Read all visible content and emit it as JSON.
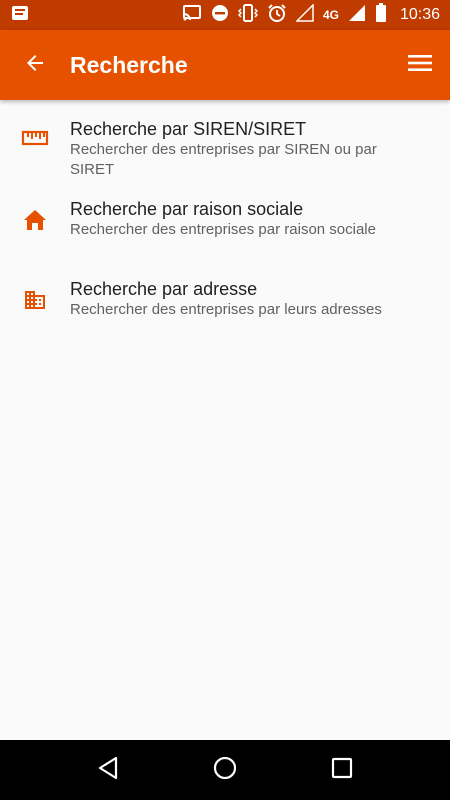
{
  "status_bar": {
    "time": "10:36",
    "network": "4G",
    "icons": [
      "notification-icon",
      "cast-icon",
      "do-not-disturb-icon",
      "vibrate-icon",
      "alarm-icon",
      "signal-icon",
      "signal-4g-icon",
      "battery-icon"
    ]
  },
  "app_bar": {
    "title": "Recherche",
    "back_icon": "arrow-back-icon",
    "menu_icon": "menu-icon"
  },
  "search_options": [
    {
      "icon": "ruler-icon",
      "title": "Recherche par SIREN/SIRET",
      "subtitle": "Rechercher des entreprises par SIREN ou par SIRET"
    },
    {
      "icon": "home-icon",
      "title": "Recherche par raison sociale",
      "subtitle": "Rechercher des entreprises par raison sociale"
    },
    {
      "icon": "business-icon",
      "title": "Recherche par adresse",
      "subtitle": "Rechercher des entreprises par leurs adresses"
    }
  ],
  "nav_bar": {
    "buttons": [
      "back-nav-icon",
      "home-nav-icon",
      "recents-nav-icon"
    ]
  },
  "colors": {
    "status_bar": "#bf3b00",
    "app_bar": "#e65100",
    "accent_icon": "#e65100",
    "background": "#fafafa"
  }
}
